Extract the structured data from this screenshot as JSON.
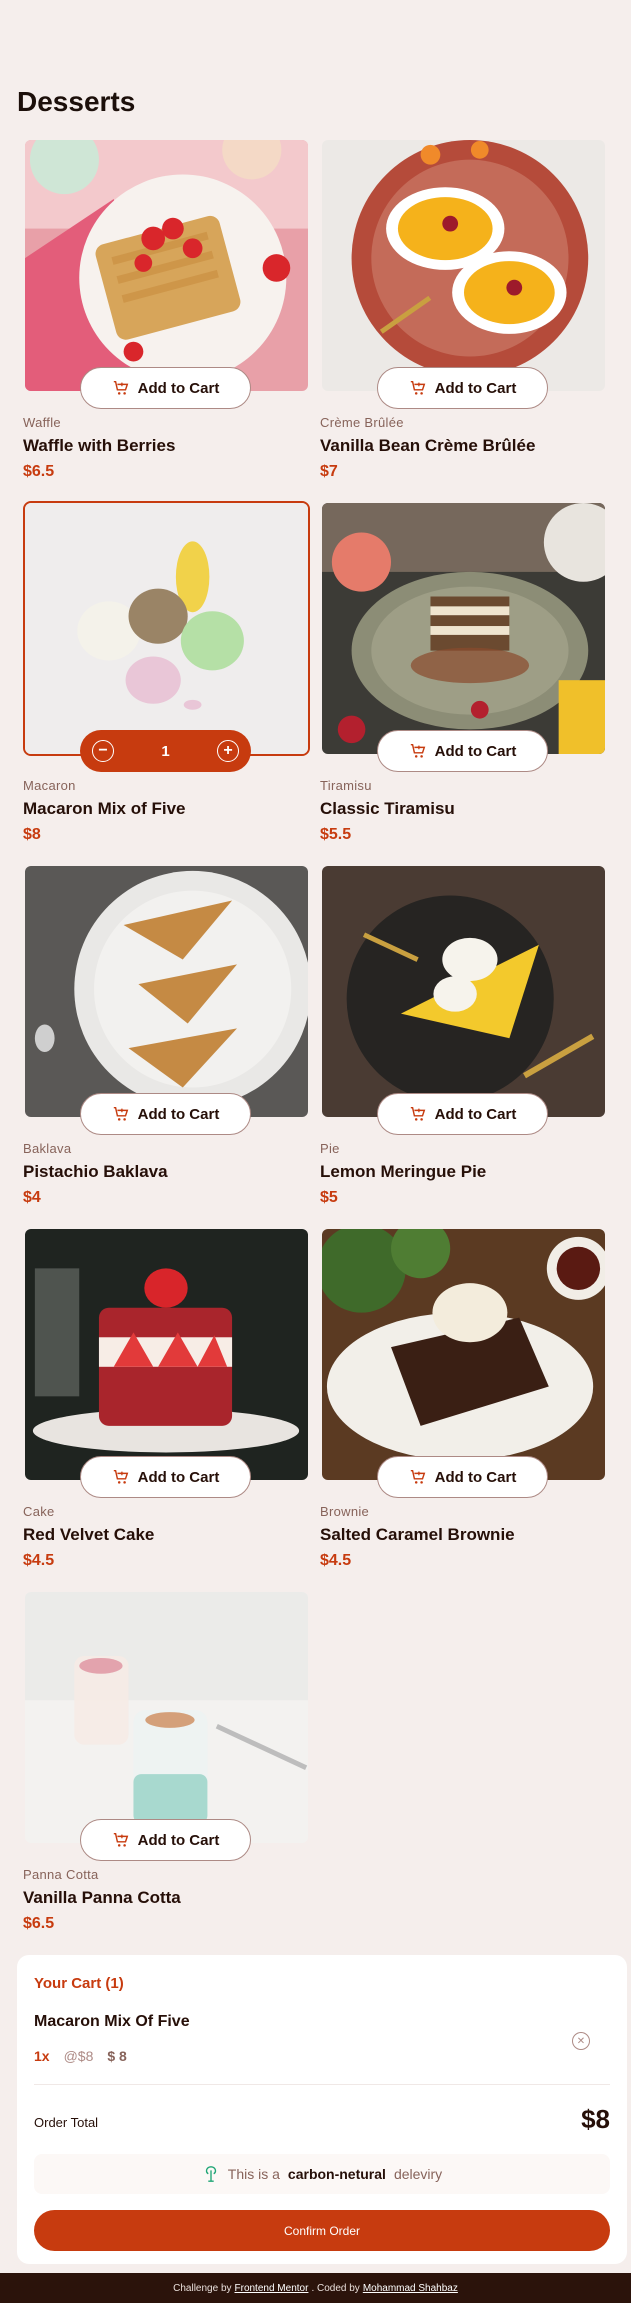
{
  "page": {
    "title": "Desserts"
  },
  "colors": {
    "accent": "#c73b0f",
    "background": "#f5eeec",
    "text": "#260f08",
    "muted": "#87635a"
  },
  "products": [
    {
      "category": "Waffle",
      "name": "Waffle with Berries",
      "price": "$6.5",
      "button": "Add to Cart",
      "in_cart": false
    },
    {
      "category": "Crème Brûlée",
      "name": "Vanilla Bean Crème Brûlée",
      "price": "$7",
      "button": "Add to Cart",
      "in_cart": false
    },
    {
      "category": "Macaron",
      "name": "Macaron Mix of Five",
      "price": "$8",
      "button": "Add to Cart",
      "in_cart": true,
      "quantity": "1"
    },
    {
      "category": "Tiramisu",
      "name": "Classic Tiramisu",
      "price": "$5.5",
      "button": "Add to Cart",
      "in_cart": false
    },
    {
      "category": "Baklava",
      "name": "Pistachio Baklava",
      "price": "$4",
      "button": "Add to Cart",
      "in_cart": false
    },
    {
      "category": "Pie",
      "name": "Lemon Meringue Pie",
      "price": "$5",
      "button": "Add to Cart",
      "in_cart": false
    },
    {
      "category": "Cake",
      "name": "Red Velvet Cake",
      "price": "$4.5",
      "button": "Add to Cart",
      "in_cart": false
    },
    {
      "category": "Brownie",
      "name": "Salted Caramel Brownie",
      "price": "$4.5",
      "button": "Add to Cart",
      "in_cart": false
    },
    {
      "category": "Panna Cotta",
      "name": "Vanilla Panna Cotta",
      "price": "$6.5",
      "button": "Add to Cart",
      "in_cart": false
    }
  ],
  "cart": {
    "title": "Your Cart (1)",
    "items": [
      {
        "name": "Macaron Mix Of Five",
        "quantity": "1x",
        "unit_price": "@$8",
        "total": "$ 8"
      }
    ],
    "total_label": "Order Total",
    "total_value": "$8",
    "eco_prefix": "This is a",
    "eco_bold": "carbon-netural",
    "eco_suffix": "deleviry",
    "confirm_label": "Confirm Order"
  },
  "footer": {
    "prefix": "Challenge by",
    "link1": "Frontend Mentor",
    "middle": ". Coded by",
    "link2": "Mohammad Shahbaz"
  }
}
